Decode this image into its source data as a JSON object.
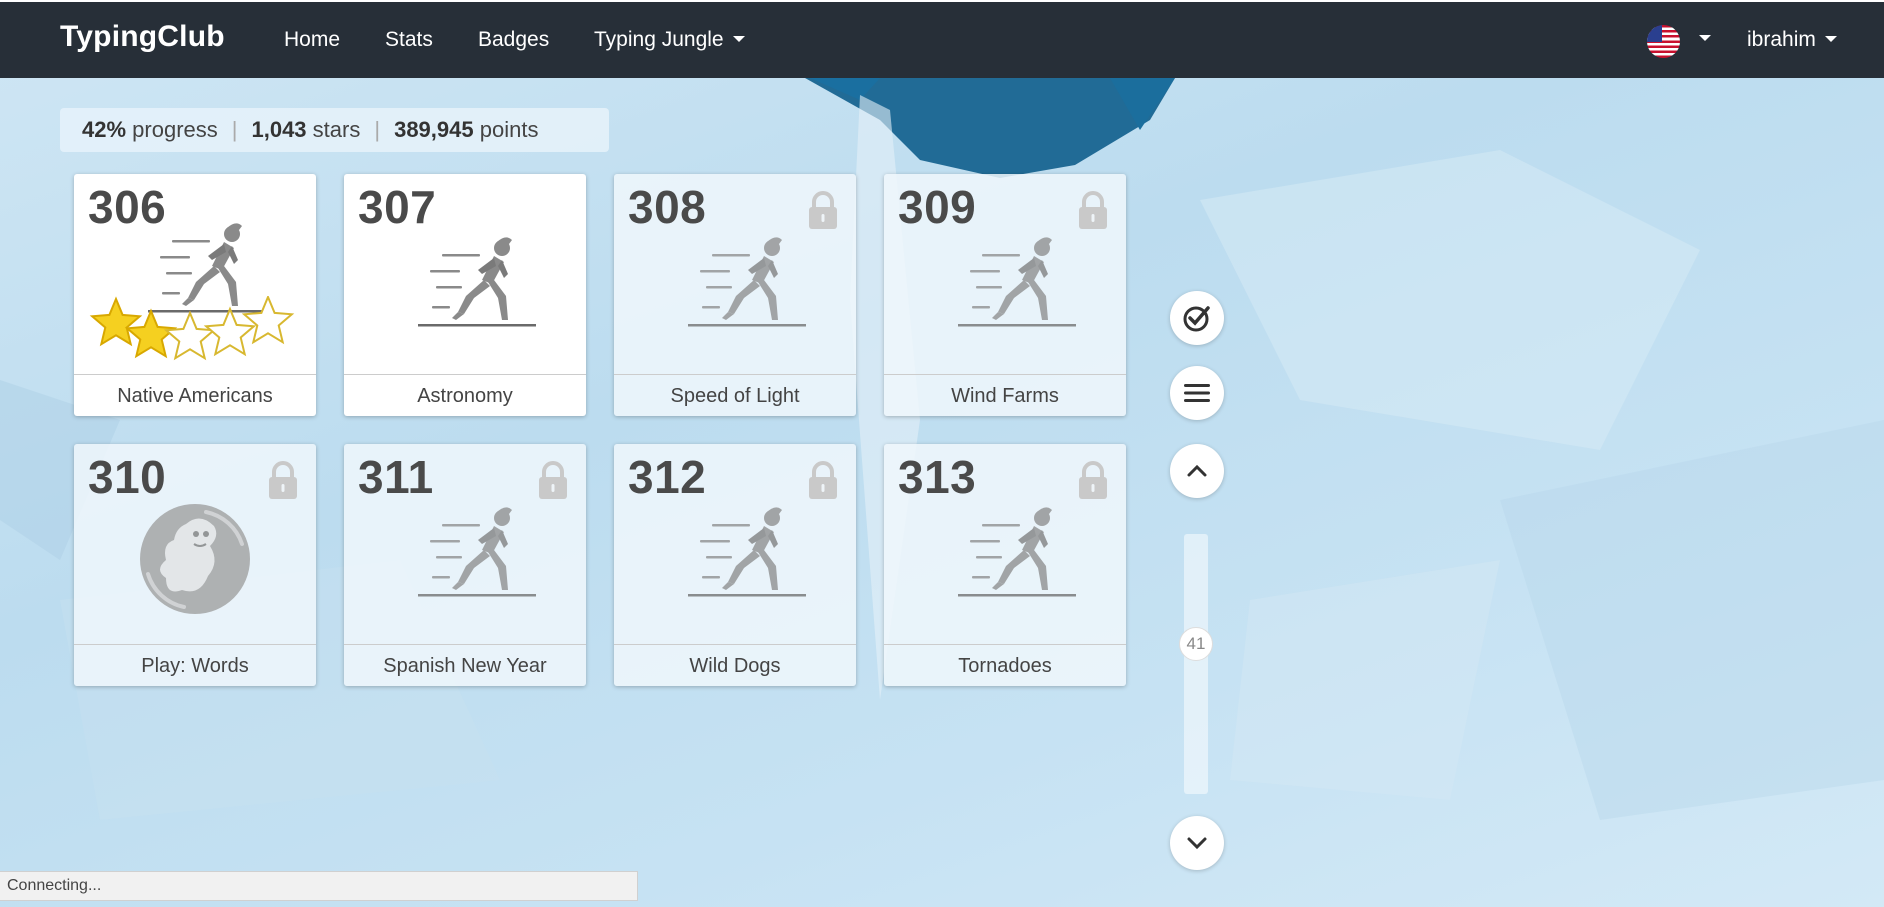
{
  "navbar": {
    "brand": "TypingClub",
    "links": [
      "Home",
      "Stats",
      "Badges",
      "Typing Jungle"
    ],
    "user": "ibrahim"
  },
  "progress": {
    "percent": "42%",
    "percent_label": "progress",
    "stars": "1,043",
    "stars_label": "stars",
    "points": "389,945",
    "points_label": "points"
  },
  "lessons": [
    {
      "number": "306",
      "title": "Native Americans",
      "locked": false,
      "stars": 2,
      "image": "runner-icon"
    },
    {
      "number": "307",
      "title": "Astronomy",
      "locked": false,
      "stars": 0,
      "image": "runner-icon"
    },
    {
      "number": "308",
      "title": "Speed of Light",
      "locked": true,
      "stars": 0,
      "image": "runner-icon"
    },
    {
      "number": "309",
      "title": "Wind Farms",
      "locked": true,
      "stars": 0,
      "image": "runner-icon"
    },
    {
      "number": "310",
      "title": "Play: Words",
      "locked": true,
      "stars": 0,
      "image": "game-creature-icon"
    },
    {
      "number": "311",
      "title": "Spanish New Year",
      "locked": true,
      "stars": 0,
      "image": "runner-icon"
    },
    {
      "number": "312",
      "title": "Wild Dogs",
      "locked": true,
      "stars": 0,
      "image": "runner-icon"
    },
    {
      "number": "313",
      "title": "Tornadoes",
      "locked": true,
      "stars": 0,
      "image": "runner-icon"
    }
  ],
  "side_controls": {
    "scroll_position": "41"
  },
  "status": {
    "text": "Connecting..."
  },
  "colors": {
    "navbar": "#272f38",
    "star_filled": "#f5d020",
    "text_dark": "#4a4a4a"
  }
}
